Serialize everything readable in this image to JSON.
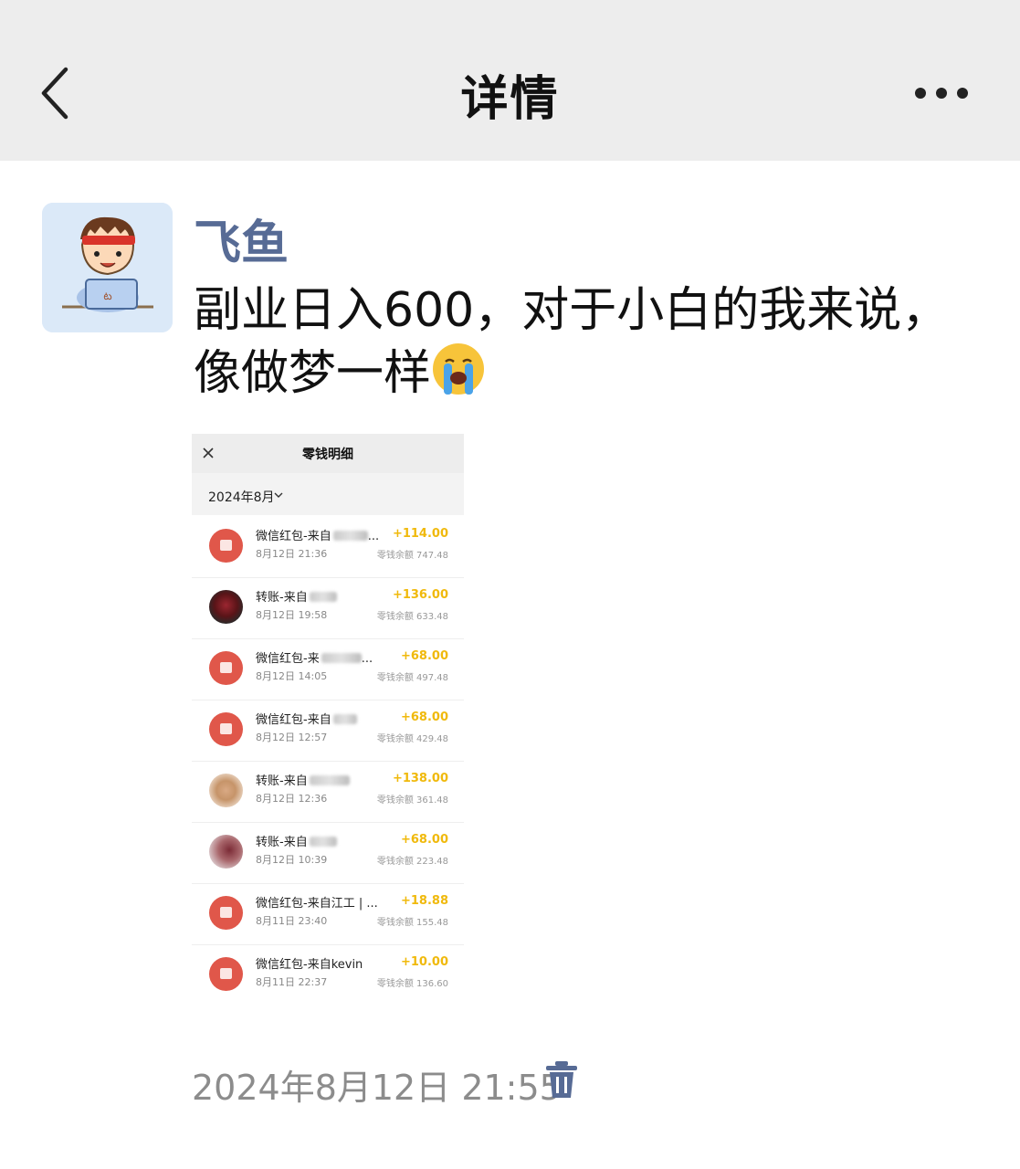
{
  "header": {
    "title": "详情",
    "back_icon": "chevron-left-icon",
    "more_icon": "more-dots-icon"
  },
  "post": {
    "author": "飞鱼",
    "text": "副业日入600，对于小白的我来说，像做梦一样",
    "emoji": "crying-face-emoji",
    "timestamp": "2024年8月12日 21:55",
    "delete_icon": "trash-icon"
  },
  "screenshot": {
    "title": "零钱明细",
    "close_icon": "close-icon",
    "month": "2024年8月",
    "transactions": [
      {
        "title": "微信红包-来自",
        "suffix": "...",
        "time": "8月12日 21:36",
        "amount": "+114.00",
        "balance": "零钱余额 747.48",
        "icon": "red-packet-icon"
      },
      {
        "title": "转账-来自",
        "suffix": "",
        "time": "8月12日 19:58",
        "amount": "+136.00",
        "balance": "零钱余额 633.48",
        "icon": "avatar-photo"
      },
      {
        "title": "微信红包-来",
        "suffix": "...",
        "time": "8月12日 14:05",
        "amount": "+68.00",
        "balance": "零钱余额 497.48",
        "icon": "red-packet-icon"
      },
      {
        "title": "微信红包-来自",
        "suffix": "",
        "time": "8月12日 12:57",
        "amount": "+68.00",
        "balance": "零钱余额 429.48",
        "icon": "red-packet-icon"
      },
      {
        "title": "转账-来自",
        "suffix": "",
        "time": "8月12日 12:36",
        "amount": "+138.00",
        "balance": "零钱余额 361.48",
        "icon": "avatar-photo"
      },
      {
        "title": "转账-来自",
        "suffix": "",
        "time": "8月12日 10:39",
        "amount": "+68.00",
        "balance": "零钱余额 223.48",
        "icon": "avatar-photo"
      },
      {
        "title": "微信红包-来自江工 | ...",
        "suffix": "",
        "time": "8月11日 23:40",
        "amount": "+18.88",
        "balance": "零钱余额 155.48",
        "icon": "red-packet-icon"
      },
      {
        "title": "微信红包-来自kevin",
        "suffix": "",
        "time": "8月11日 22:37",
        "amount": "+10.00",
        "balance": "零钱余额 136.60",
        "icon": "red-packet-icon"
      }
    ]
  }
}
